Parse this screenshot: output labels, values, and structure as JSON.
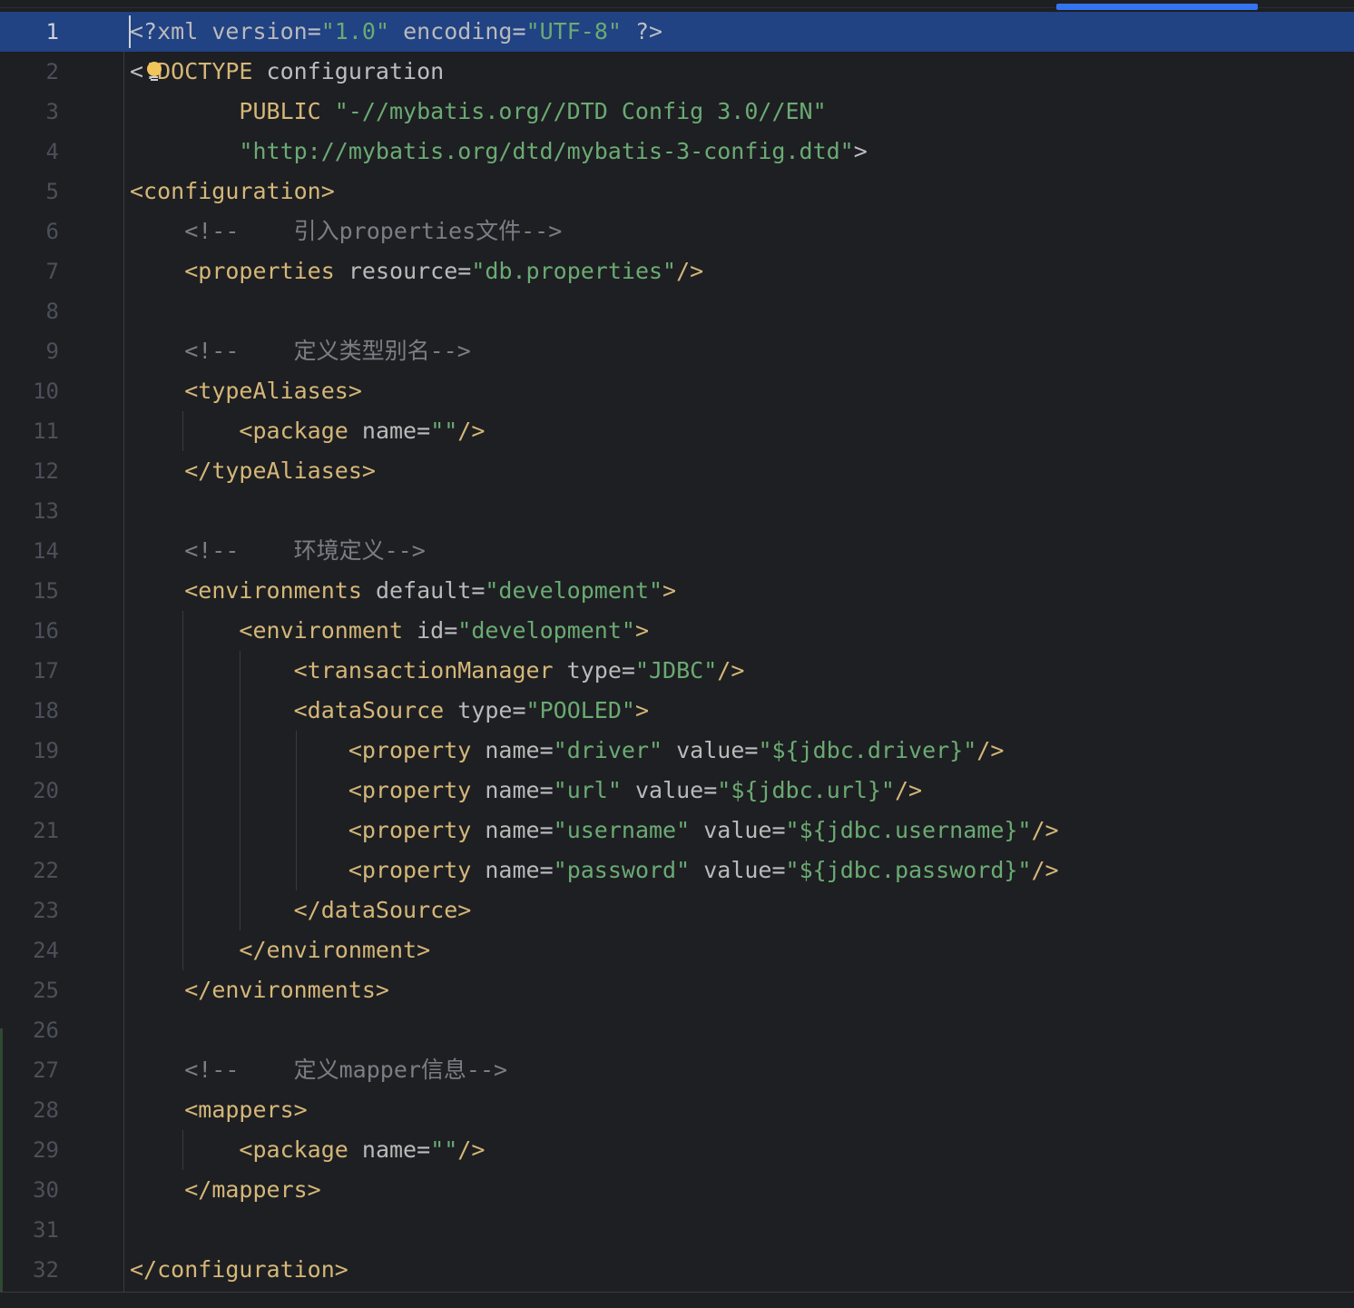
{
  "editor": {
    "language": "xml",
    "current_line": 1,
    "lines": [
      {
        "n": "1",
        "tokens": [
          {
            "t": "punct",
            "v": "<?"
          },
          {
            "t": "attr",
            "v": "xml version"
          },
          {
            "t": "punct",
            "v": "="
          },
          {
            "t": "val",
            "v": "\"1.0\""
          },
          {
            "t": "punct",
            "v": " "
          },
          {
            "t": "attr",
            "v": "encoding"
          },
          {
            "t": "punct",
            "v": "="
          },
          {
            "t": "val",
            "v": "\"UTF-8\""
          },
          {
            "t": "punct",
            "v": " ?>"
          }
        ]
      },
      {
        "n": "2",
        "tokens": [
          {
            "t": "punct",
            "v": "<!"
          },
          {
            "t": "kw",
            "v": "DOCTYPE"
          },
          {
            "t": "punct",
            "v": " configuration"
          }
        ]
      },
      {
        "n": "3",
        "tokens": [
          {
            "t": "punct",
            "v": "        "
          },
          {
            "t": "kw",
            "v": "PUBLIC"
          },
          {
            "t": "punct",
            "v": " "
          },
          {
            "t": "val",
            "v": "\"-//mybatis.org//DTD Config 3.0//EN\""
          }
        ]
      },
      {
        "n": "4",
        "tokens": [
          {
            "t": "punct",
            "v": "        "
          },
          {
            "t": "val",
            "v": "\"http://mybatis.org/dtd/mybatis-3-config.dtd\""
          },
          {
            "t": "punct",
            "v": ">"
          }
        ]
      },
      {
        "n": "5",
        "tokens": [
          {
            "t": "tag",
            "v": "<configuration>"
          }
        ]
      },
      {
        "n": "6",
        "tokens": [
          {
            "t": "cmt",
            "v": "    <!--    引入properties文件-->"
          }
        ]
      },
      {
        "n": "7",
        "tokens": [
          {
            "t": "punct",
            "v": "    "
          },
          {
            "t": "tag",
            "v": "<properties"
          },
          {
            "t": "punct",
            "v": " "
          },
          {
            "t": "attr",
            "v": "resource"
          },
          {
            "t": "punct",
            "v": "="
          },
          {
            "t": "val",
            "v": "\"db.properties\""
          },
          {
            "t": "tag",
            "v": "/>"
          }
        ]
      },
      {
        "n": "8",
        "tokens": []
      },
      {
        "n": "9",
        "tokens": [
          {
            "t": "cmt",
            "v": "    <!--    定义类型别名-->"
          }
        ]
      },
      {
        "n": "10",
        "tokens": [
          {
            "t": "punct",
            "v": "    "
          },
          {
            "t": "tag",
            "v": "<typeAliases>"
          }
        ]
      },
      {
        "n": "11",
        "tokens": [
          {
            "t": "punct",
            "v": "        "
          },
          {
            "t": "tag",
            "v": "<package"
          },
          {
            "t": "punct",
            "v": " "
          },
          {
            "t": "attr",
            "v": "name"
          },
          {
            "t": "punct",
            "v": "="
          },
          {
            "t": "val",
            "v": "\"\""
          },
          {
            "t": "tag",
            "v": "/>"
          }
        ]
      },
      {
        "n": "12",
        "tokens": [
          {
            "t": "punct",
            "v": "    "
          },
          {
            "t": "tag",
            "v": "</typeAliases>"
          }
        ]
      },
      {
        "n": "13",
        "tokens": []
      },
      {
        "n": "14",
        "tokens": [
          {
            "t": "cmt",
            "v": "    <!--    环境定义-->"
          }
        ]
      },
      {
        "n": "15",
        "tokens": [
          {
            "t": "punct",
            "v": "    "
          },
          {
            "t": "tag",
            "v": "<environments"
          },
          {
            "t": "punct",
            "v": " "
          },
          {
            "t": "attr",
            "v": "default"
          },
          {
            "t": "punct",
            "v": "="
          },
          {
            "t": "val",
            "v": "\"development\""
          },
          {
            "t": "tag",
            "v": ">"
          }
        ]
      },
      {
        "n": "16",
        "tokens": [
          {
            "t": "punct",
            "v": "        "
          },
          {
            "t": "tag",
            "v": "<environment"
          },
          {
            "t": "punct",
            "v": " "
          },
          {
            "t": "attr",
            "v": "id"
          },
          {
            "t": "punct",
            "v": "="
          },
          {
            "t": "val",
            "v": "\"development\""
          },
          {
            "t": "tag",
            "v": ">"
          }
        ]
      },
      {
        "n": "17",
        "tokens": [
          {
            "t": "punct",
            "v": "            "
          },
          {
            "t": "tag",
            "v": "<transactionManager"
          },
          {
            "t": "punct",
            "v": " "
          },
          {
            "t": "attr",
            "v": "type"
          },
          {
            "t": "punct",
            "v": "="
          },
          {
            "t": "val",
            "v": "\"JDBC\""
          },
          {
            "t": "tag",
            "v": "/>"
          }
        ]
      },
      {
        "n": "18",
        "tokens": [
          {
            "t": "punct",
            "v": "            "
          },
          {
            "t": "tag",
            "v": "<dataSource"
          },
          {
            "t": "punct",
            "v": " "
          },
          {
            "t": "attr",
            "v": "type"
          },
          {
            "t": "punct",
            "v": "="
          },
          {
            "t": "val",
            "v": "\"POOLED\""
          },
          {
            "t": "tag",
            "v": ">"
          }
        ]
      },
      {
        "n": "19",
        "tokens": [
          {
            "t": "punct",
            "v": "                "
          },
          {
            "t": "tag",
            "v": "<property"
          },
          {
            "t": "punct",
            "v": " "
          },
          {
            "t": "attr",
            "v": "name"
          },
          {
            "t": "punct",
            "v": "="
          },
          {
            "t": "val",
            "v": "\"driver\""
          },
          {
            "t": "punct",
            "v": " "
          },
          {
            "t": "attr",
            "v": "value"
          },
          {
            "t": "punct",
            "v": "="
          },
          {
            "t": "val",
            "v": "\"${jdbc.driver}\""
          },
          {
            "t": "tag",
            "v": "/>"
          }
        ]
      },
      {
        "n": "20",
        "tokens": [
          {
            "t": "punct",
            "v": "                "
          },
          {
            "t": "tag",
            "v": "<property"
          },
          {
            "t": "punct",
            "v": " "
          },
          {
            "t": "attr",
            "v": "name"
          },
          {
            "t": "punct",
            "v": "="
          },
          {
            "t": "val",
            "v": "\"url\""
          },
          {
            "t": "punct",
            "v": " "
          },
          {
            "t": "attr",
            "v": "value"
          },
          {
            "t": "punct",
            "v": "="
          },
          {
            "t": "val",
            "v": "\"${jdbc.url}\""
          },
          {
            "t": "tag",
            "v": "/>"
          }
        ]
      },
      {
        "n": "21",
        "tokens": [
          {
            "t": "punct",
            "v": "                "
          },
          {
            "t": "tag",
            "v": "<property"
          },
          {
            "t": "punct",
            "v": " "
          },
          {
            "t": "attr",
            "v": "name"
          },
          {
            "t": "punct",
            "v": "="
          },
          {
            "t": "val",
            "v": "\"username\""
          },
          {
            "t": "punct",
            "v": " "
          },
          {
            "t": "attr",
            "v": "value"
          },
          {
            "t": "punct",
            "v": "="
          },
          {
            "t": "val",
            "v": "\"${jdbc.username}\""
          },
          {
            "t": "tag",
            "v": "/>"
          }
        ]
      },
      {
        "n": "22",
        "tokens": [
          {
            "t": "punct",
            "v": "                "
          },
          {
            "t": "tag",
            "v": "<property"
          },
          {
            "t": "punct",
            "v": " "
          },
          {
            "t": "attr",
            "v": "name"
          },
          {
            "t": "punct",
            "v": "="
          },
          {
            "t": "val",
            "v": "\"password\""
          },
          {
            "t": "punct",
            "v": " "
          },
          {
            "t": "attr",
            "v": "value"
          },
          {
            "t": "punct",
            "v": "="
          },
          {
            "t": "val",
            "v": "\"${jdbc.password}\""
          },
          {
            "t": "tag",
            "v": "/>"
          }
        ]
      },
      {
        "n": "23",
        "tokens": [
          {
            "t": "punct",
            "v": "            "
          },
          {
            "t": "tag",
            "v": "</dataSource>"
          }
        ]
      },
      {
        "n": "24",
        "tokens": [
          {
            "t": "punct",
            "v": "        "
          },
          {
            "t": "tag",
            "v": "</environment>"
          }
        ]
      },
      {
        "n": "25",
        "tokens": [
          {
            "t": "punct",
            "v": "    "
          },
          {
            "t": "tag",
            "v": "</environments>"
          }
        ]
      },
      {
        "n": "26",
        "tokens": []
      },
      {
        "n": "27",
        "tokens": [
          {
            "t": "cmt",
            "v": "    <!--    定义mapper信息-->"
          }
        ]
      },
      {
        "n": "28",
        "tokens": [
          {
            "t": "punct",
            "v": "    "
          },
          {
            "t": "tag",
            "v": "<mappers>"
          }
        ]
      },
      {
        "n": "29",
        "tokens": [
          {
            "t": "punct",
            "v": "        "
          },
          {
            "t": "tag",
            "v": "<package"
          },
          {
            "t": "punct",
            "v": " "
          },
          {
            "t": "attr",
            "v": "name"
          },
          {
            "t": "punct",
            "v": "="
          },
          {
            "t": "val",
            "v": "\"\""
          },
          {
            "t": "tag",
            "v": "/>"
          }
        ]
      },
      {
        "n": "30",
        "tokens": [
          {
            "t": "punct",
            "v": "    "
          },
          {
            "t": "tag",
            "v": "</mappers>"
          }
        ]
      },
      {
        "n": "31",
        "tokens": []
      },
      {
        "n": "32",
        "tokens": [
          {
            "t": "tag",
            "v": "</configuration>"
          }
        ]
      }
    ]
  },
  "icons": {
    "intention_bulb": "lightbulb-icon"
  },
  "colors": {
    "background": "#1e1f22",
    "current_line": "#214283",
    "tag": "#d5b778",
    "attribute": "#bababa",
    "string": "#6aab73",
    "comment": "#7a7e85",
    "line_number": "#4b5059",
    "scroll_marker": "#3574f0"
  }
}
